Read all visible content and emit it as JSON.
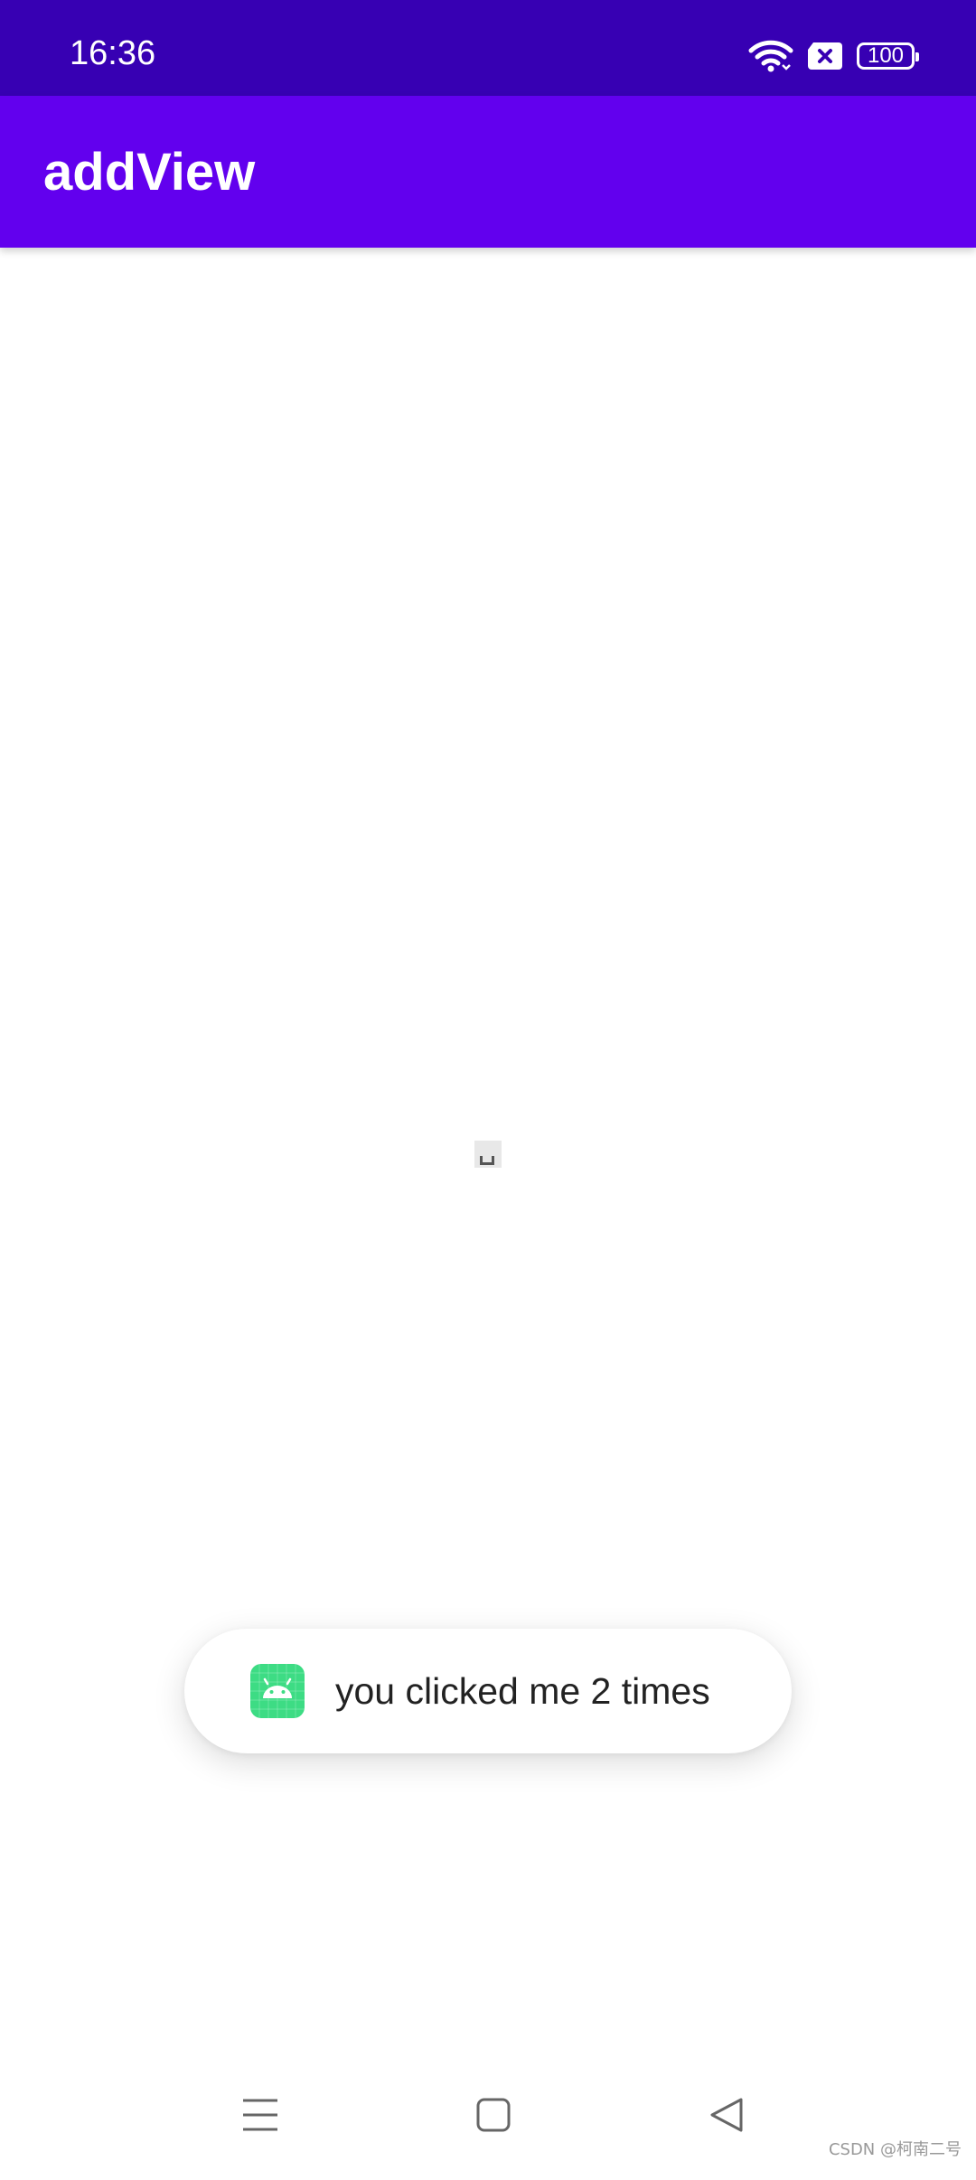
{
  "status_bar": {
    "time": "16:36",
    "battery_level": "100",
    "icons": [
      "wifi-icon",
      "sim-card-off-icon",
      "battery-icon"
    ]
  },
  "app_bar": {
    "title": "addView"
  },
  "toast": {
    "icon": "android-icon",
    "message": "you clicked me 2 times"
  },
  "nav_bar": {
    "buttons": [
      "menu-icon",
      "home-icon",
      "back-icon"
    ]
  },
  "watermark": "CSDN @柯南二号",
  "colors": {
    "status_bar": "#3700b3",
    "app_bar": "#6200ee",
    "android_green": "#3ddc84"
  }
}
